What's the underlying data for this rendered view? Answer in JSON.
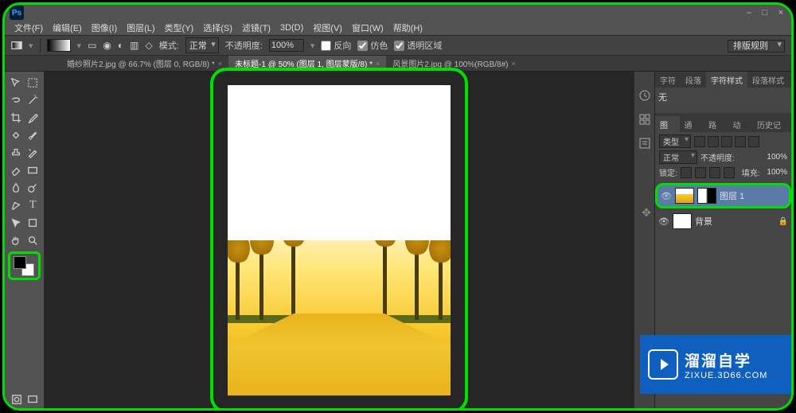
{
  "app": {
    "logo_text": "Ps"
  },
  "window": {
    "min": "–",
    "max": "□",
    "close": "×"
  },
  "menu": {
    "file": "文件(F)",
    "edit": "编辑(E)",
    "image": "图像(I)",
    "layer": "图层(L)",
    "type": "类型(Y)",
    "select": "选择(S)",
    "filter": "滤镜(T)",
    "threeD": "3D(D)",
    "view": "视图(V)",
    "window": "窗口(W)",
    "help": "帮助(H)"
  },
  "options": {
    "mode_label": "模式:",
    "mode_value": "正常",
    "opacity_label": "不透明度:",
    "opacity_value": "100%",
    "reverse": "反向",
    "dither": "仿色",
    "transparency": "透明区域",
    "workspace_switch": "排版规则"
  },
  "tabs": {
    "t1": "婚纱照片2.jpg @ 66.7% (图层 0, RGB/8) *",
    "t2": "未标题-1 @ 50% (图层 1, 图层蒙版/8) *",
    "t3": "风景图片2.jpg @ 100%(RGB/8#)",
    "close": "×"
  },
  "char_panel": {
    "tabs": {
      "char": "字符",
      "para": "段落",
      "char_style": "字符样式",
      "para_style": "段落样式"
    },
    "value": "无"
  },
  "layers_panel": {
    "tabs": {
      "layers": "图层",
      "channels": "通道",
      "paths": "路径",
      "actions": "动作",
      "history": "历史记录"
    },
    "kind_label": "类型",
    "blend": "正常",
    "opacity_label": "不透明度:",
    "opacity": "100%",
    "lock_label": "锁定:",
    "fill_label": "填充:",
    "fill": "100%",
    "layer1": "图层 1",
    "background": "背景"
  },
  "watermark": {
    "title": "溜溜自学",
    "sub": "ZIXUE.3D66.COM"
  }
}
